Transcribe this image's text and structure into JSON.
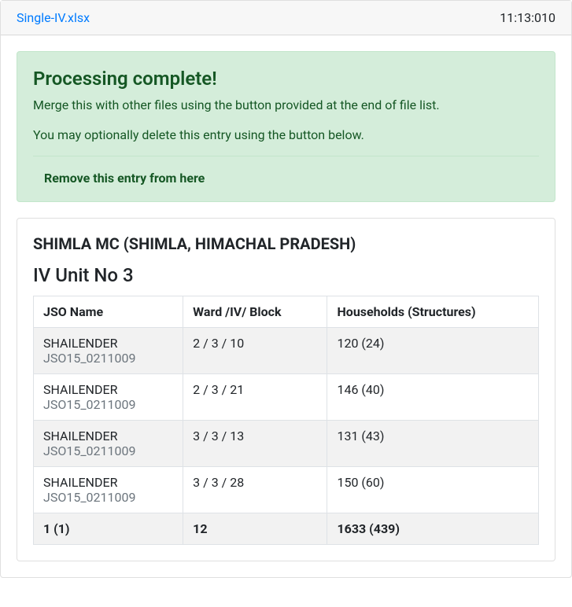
{
  "header": {
    "filename": "Single-IV.xlsx",
    "timestamp": "11:13:010"
  },
  "alert": {
    "title": "Processing complete!",
    "line1": "Merge this with other files using the button provided at the end of file list.",
    "line2": "You may optionally delete this entry using the button below.",
    "remove_label": "Remove this entry from here"
  },
  "result": {
    "location_title": "SHIMLA MC (SHIMLA, HIMACHAL PRADESH)",
    "unit_title": "IV Unit No 3",
    "columns": {
      "c0": "JSO Name",
      "c1": "Ward /IV/ Block",
      "c2": "Households (Structures)"
    },
    "rows": [
      {
        "name": "SHAILENDER",
        "id": "JSO15_0211009",
        "wib": "2 / 3 / 10",
        "hs": "120 (24)"
      },
      {
        "name": "SHAILENDER",
        "id": "JSO15_0211009",
        "wib": "2 / 3 / 21",
        "hs": "146 (40)"
      },
      {
        "name": "SHAILENDER",
        "id": "JSO15_0211009",
        "wib": "3 / 3 / 13",
        "hs": "131 (43)"
      },
      {
        "name": "SHAILENDER",
        "id": "JSO15_0211009",
        "wib": "3 / 3 / 28",
        "hs": "150 (60)"
      }
    ],
    "footer": {
      "c0": "1 (1)",
      "c1": "12",
      "c2": "1633 (439)"
    }
  }
}
